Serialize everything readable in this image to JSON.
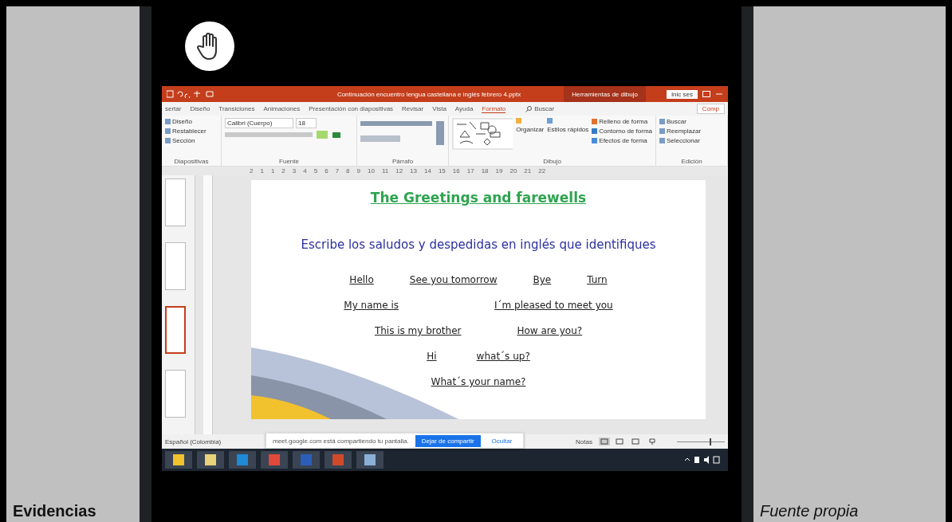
{
  "document": {
    "left_label": "Evidencias",
    "right_label": "Fuente propia"
  },
  "powerpoint": {
    "title": "Continuación encuentro lengua castellana e inglés febrero 4.pptx",
    "context_tab": "Herramientas de dibujo",
    "sign_in": "Inic ses",
    "tabs": [
      {
        "label": "sertar",
        "selected": false
      },
      {
        "label": "Diseño",
        "selected": false
      },
      {
        "label": "Transiciones",
        "selected": false
      },
      {
        "label": "Animaciones",
        "selected": false
      },
      {
        "label": "Presentación con diapositivas",
        "selected": false
      },
      {
        "label": "Revisar",
        "selected": false
      },
      {
        "label": "Vista",
        "selected": false
      },
      {
        "label": "Ayuda",
        "selected": false
      },
      {
        "label": "Formato",
        "selected": true
      }
    ],
    "search": "Buscar",
    "share": "Comp",
    "groups": [
      {
        "kind": "list",
        "label": "Diapositivas",
        "items": [
          "Diseño",
          "Restablecer",
          "Sección"
        ]
      },
      {
        "kind": "font",
        "label": "Fuente",
        "items": [
          "Calibri (Cuerpo)",
          "18"
        ]
      },
      {
        "kind": "paragraph",
        "label": "Párrafo"
      },
      {
        "kind": "drawing",
        "label": "Dibujo",
        "items": [
          "Organizar",
          "Estilos rápidos",
          "Relleno de forma",
          "Contorno de forma",
          "Efectos de forma"
        ]
      },
      {
        "kind": "list",
        "label": "Edición",
        "items": [
          "Buscar",
          "Reemplazar",
          "Seleccionar"
        ]
      }
    ],
    "ruler_marks": [
      "2",
      "1",
      "1",
      "2",
      "3",
      "4",
      "5",
      "6",
      "7",
      "8",
      "9",
      "10",
      "11",
      "12",
      "13",
      "14",
      "15",
      "16",
      "17",
      "18",
      "19",
      "20",
      "21",
      "22"
    ],
    "thumbnails": [
      {
        "selected": false
      },
      {
        "selected": false
      },
      {
        "selected": true
      },
      {
        "selected": false
      }
    ],
    "slide": {
      "title": "The Greetings and farewells",
      "instruction": "Escribe los saludos y despedidas en inglés que identifiques",
      "rows": [
        [
          "Hello",
          "See you tomorrow",
          "Bye",
          "Turn"
        ],
        [
          "My name is",
          "I´m pleased to meet you"
        ],
        [
          "This is my brother",
          "How are you?"
        ],
        [
          "Hi",
          "what´s up?"
        ],
        [
          "What´s your name?"
        ]
      ]
    },
    "status": {
      "language": "Español (Colombia)",
      "notes": "Notas",
      "zoom": {
        "level": 0.7
      }
    },
    "share_bar": {
      "message": "meet.google.com está compartiendo tu pantalla.",
      "stop": "Dejar de compartir",
      "hide": "Ocultar"
    }
  }
}
